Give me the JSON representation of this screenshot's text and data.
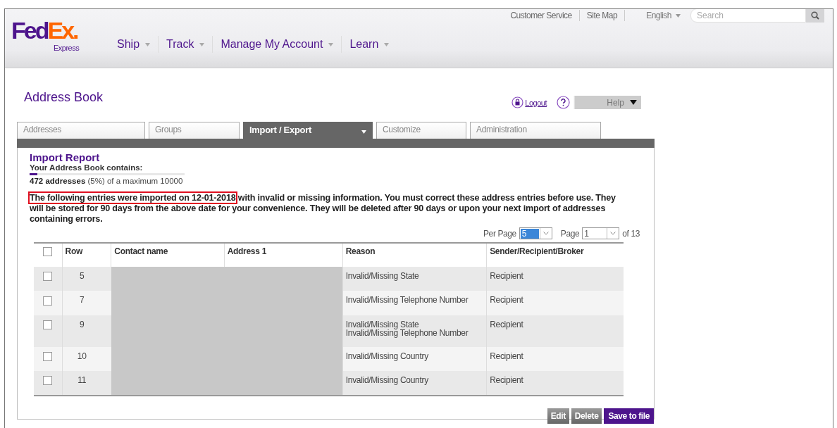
{
  "header": {
    "logo": {
      "part1": "Fed",
      "part2": "Ex.",
      "tagline": "Express"
    },
    "nav": [
      {
        "label": "Ship"
      },
      {
        "label": "Track"
      },
      {
        "label": "Manage My Account"
      },
      {
        "label": "Learn"
      }
    ],
    "utility_links": [
      "Customer Service",
      "Site Map"
    ],
    "language": "English",
    "search": {
      "placeholder": "Search"
    }
  },
  "page_title": "Address Book",
  "logout": "Logout",
  "help": "Help",
  "tabs": [
    {
      "label": "Addresses",
      "selected": false
    },
    {
      "label": "Groups",
      "selected": false
    },
    {
      "label": "Import / Export",
      "selected": true
    },
    {
      "label": "Customize",
      "selected": false
    },
    {
      "label": "Administration",
      "selected": false
    }
  ],
  "report": {
    "title": "Import Report",
    "contains_label": "Your Address Book contains:",
    "usage": {
      "level": 0.05,
      "text": "**472 addresses** (5%) of a maximum 10000"
    },
    "message_highlight": "The following entries were imported on 12-01-2018",
    "message_rest": " with invalid or missing information. You must correct these address entries before use. They will be stored for 90 days from the above date for your convenience. They will be deleted after 90 days or upon your next import of addresses containing errors.",
    "pager": {
      "per_page_label": "Per Page",
      "per_page_value": "5",
      "page_label": "Page",
      "page_value": "1",
      "page_total": "of 13"
    },
    "table": {
      "header_checked": false,
      "columns": [
        "Row",
        "Contact name",
        "Address 1",
        "Reason",
        "Sender/Recipient/Broker"
      ],
      "rows": [
        {
          "checked": false,
          "row": "5",
          "redacted": true,
          "reason": [
            "Invalid/Missing State"
          ],
          "party": "Recipient"
        },
        {
          "checked": false,
          "row": "7",
          "redacted": true,
          "reason": [
            "Invalid/Missing Telephone Number"
          ],
          "party": "Recipient"
        },
        {
          "checked": false,
          "row": "9",
          "redacted": true,
          "reason": [
            "Invalid/Missing State",
            "Invalid/Missing Telephone Number"
          ],
          "party": "Recipient"
        },
        {
          "checked": false,
          "row": "10",
          "redacted": true,
          "reason": [
            "Invalid/Missing Country"
          ],
          "party": "Recipient"
        },
        {
          "checked": false,
          "row": "11",
          "redacted": true,
          "reason": [
            "Invalid/Missing Country"
          ],
          "party": "Recipient"
        }
      ]
    },
    "buttons": [
      {
        "label": "Edit",
        "kind": "secondary"
      },
      {
        "label": "Delete",
        "kind": "secondary"
      },
      {
        "label": "Save to file",
        "kind": "primary"
      }
    ]
  }
}
